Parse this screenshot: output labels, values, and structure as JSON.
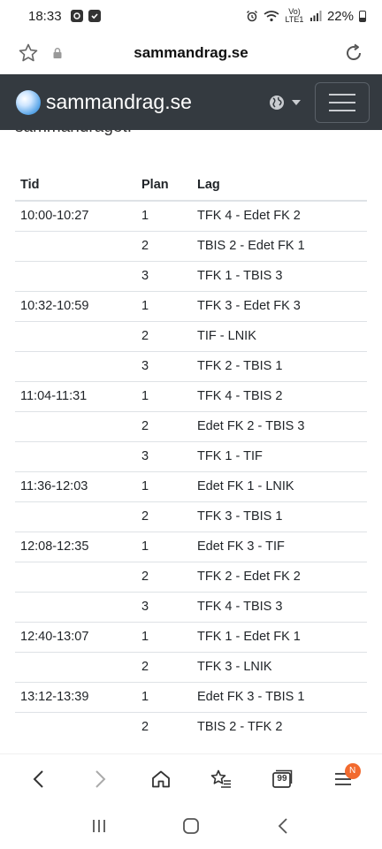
{
  "status_bar": {
    "time": "18:33",
    "network": "Vo) LTE1",
    "battery": "22%"
  },
  "browser": {
    "url": "sammandrag.se",
    "tab_count": "99",
    "menu_badge": "N"
  },
  "navbar": {
    "brand": "sammandrag.se"
  },
  "content": {
    "clipped_text": "sammandraget.",
    "table": {
      "headers": [
        "Tid",
        "Plan",
        "Lag"
      ],
      "rows": [
        {
          "tid": "10:00-10:27",
          "plan": "1",
          "lag": "TFK 4 - Edet FK 2"
        },
        {
          "tid": "",
          "plan": "2",
          "lag": "TBIS 2 - Edet FK 1"
        },
        {
          "tid": "",
          "plan": "3",
          "lag": "TFK 1 - TBIS 3"
        },
        {
          "tid": "10:32-10:59",
          "plan": "1",
          "lag": "TFK 3 - Edet FK 3"
        },
        {
          "tid": "",
          "plan": "2",
          "lag": "TIF - LNIK"
        },
        {
          "tid": "",
          "plan": "3",
          "lag": "TFK 2 - TBIS 1"
        },
        {
          "tid": "11:04-11:31",
          "plan": "1",
          "lag": "TFK 4 - TBIS 2"
        },
        {
          "tid": "",
          "plan": "2",
          "lag": "Edet FK 2 - TBIS 3"
        },
        {
          "tid": "",
          "plan": "3",
          "lag": "TFK 1 - TIF"
        },
        {
          "tid": "11:36-12:03",
          "plan": "1",
          "lag": "Edet FK 1 - LNIK"
        },
        {
          "tid": "",
          "plan": "2",
          "lag": "TFK 3 - TBIS 1"
        },
        {
          "tid": "12:08-12:35",
          "plan": "1",
          "lag": "Edet FK 3 - TIF"
        },
        {
          "tid": "",
          "plan": "2",
          "lag": "TFK 2 - Edet FK 2"
        },
        {
          "tid": "",
          "plan": "3",
          "lag": "TFK 4 - TBIS 3"
        },
        {
          "tid": "12:40-13:07",
          "plan": "1",
          "lag": "TFK 1 - Edet FK 1"
        },
        {
          "tid": "",
          "plan": "2",
          "lag": "TFK 3 - LNIK"
        },
        {
          "tid": "13:12-13:39",
          "plan": "1",
          "lag": "Edet FK 3 - TBIS 1"
        },
        {
          "tid": "",
          "plan": "2",
          "lag": "TBIS 2 - TFK 2"
        }
      ]
    }
  },
  "colors": {
    "navbar_bg": "#343a40",
    "badge": "#f26a2e",
    "table_border": "#dee2e6"
  },
  "icons": {
    "status_left": [
      "gallery-icon",
      "checkbox-icon"
    ],
    "status_right": [
      "alarm-icon",
      "wifi-icon",
      "signal-icon",
      "battery-icon"
    ],
    "address_bar": [
      "star-icon",
      "lock-icon",
      "reload-icon"
    ],
    "navbar": [
      "globe-icon",
      "caret-down-icon",
      "hamburger-icon"
    ],
    "toolbar": [
      "back-icon",
      "forward-icon",
      "home-icon",
      "bookmarks-icon",
      "tabs-icon",
      "menu-icon"
    ],
    "android_nav": [
      "recents-icon",
      "home-circle-icon",
      "system-back-icon"
    ]
  }
}
